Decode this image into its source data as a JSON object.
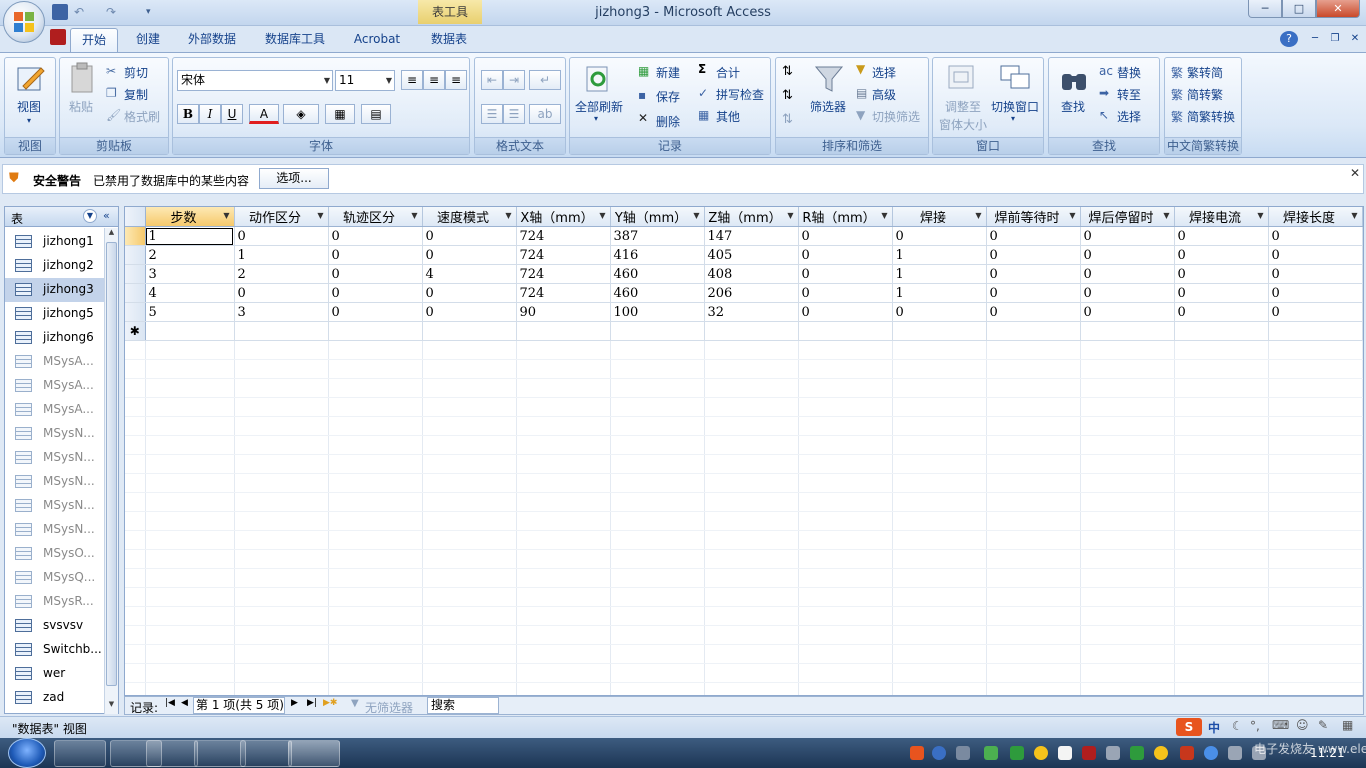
{
  "window": {
    "title": "jizhong3 - Microsoft Access",
    "context_tab": "表工具",
    "min": "─",
    "max": "□",
    "close": "✕",
    "help": "?",
    "doc_min": "─",
    "doc_restore": "❐",
    "doc_close": "✕"
  },
  "ribbon_tabs": [
    "开始",
    "创建",
    "外部数据",
    "数据库工具",
    "Acrobat",
    "数据表"
  ],
  "ribbon": {
    "view": {
      "label": "视图",
      "group": "视图"
    },
    "clipboard": {
      "paste": "粘贴",
      "cut": "剪切",
      "copy": "复制",
      "format_painter": "格式刷",
      "group": "剪贴板"
    },
    "font": {
      "name": "宋体",
      "size": "11",
      "group": "字体",
      "bold": "B",
      "italic": "I",
      "underline": "U",
      "font_color": "A"
    },
    "rich_text": {
      "group": "格式文本"
    },
    "records": {
      "refresh_all": "全部刷新",
      "new": "新建",
      "save": "保存",
      "delete": "删除",
      "totals": "合计",
      "spelling": "拼写检查",
      "more": "其他",
      "group": "记录"
    },
    "sort_filter": {
      "filter": "筛选器",
      "selection": "选择",
      "advanced": "高级",
      "toggle_filter": "切换筛选",
      "group": "排序和筛选"
    },
    "window": {
      "size_to_fit": "调整至",
      "size_to_fit2": "窗体大小",
      "switch_windows": "切换窗口",
      "group": "窗口"
    },
    "find": {
      "find": "查找",
      "replace": "替换",
      "goto": "转至",
      "select": "选择",
      "group": "查找"
    },
    "chinese": {
      "t2s": "繁转简",
      "s2t": "简转繁",
      "convert": "简繁转换",
      "group": "中文简繁转换"
    }
  },
  "security": {
    "title": "安全警告",
    "message": "已禁用了数据库中的某些内容",
    "options": "选项...",
    "close": "✕"
  },
  "nav": {
    "header": "表",
    "items": [
      {
        "name": "jizhong1",
        "system": false,
        "selected": false
      },
      {
        "name": "jizhong2",
        "system": false,
        "selected": false
      },
      {
        "name": "jizhong3",
        "system": false,
        "selected": true
      },
      {
        "name": "jizhong5",
        "system": false,
        "selected": false
      },
      {
        "name": "jizhong6",
        "system": false,
        "selected": false
      },
      {
        "name": "MSysA...",
        "system": true,
        "selected": false
      },
      {
        "name": "MSysA...",
        "system": true,
        "selected": false
      },
      {
        "name": "MSysA...",
        "system": true,
        "selected": false
      },
      {
        "name": "MSysN...",
        "system": true,
        "selected": false
      },
      {
        "name": "MSysN...",
        "system": true,
        "selected": false
      },
      {
        "name": "MSysN...",
        "system": true,
        "selected": false
      },
      {
        "name": "MSysN...",
        "system": true,
        "selected": false
      },
      {
        "name": "MSysN...",
        "system": true,
        "selected": false
      },
      {
        "name": "MSysO...",
        "system": true,
        "selected": false
      },
      {
        "name": "MSysQ...",
        "system": true,
        "selected": false
      },
      {
        "name": "MSysR...",
        "system": true,
        "selected": false
      },
      {
        "name": "svsvsv",
        "system": false,
        "selected": false
      },
      {
        "name": "Switchb...",
        "system": false,
        "selected": false
      },
      {
        "name": "wer",
        "system": false,
        "selected": false
      },
      {
        "name": "zad",
        "system": false,
        "selected": false
      }
    ]
  },
  "table": {
    "columns": [
      "步数",
      "动作区分",
      "轨迹区分",
      "速度模式",
      "X轴（mm）",
      "Y轴（mm）",
      "Z轴（mm）",
      "R轴（mm）",
      "焊接",
      "焊前等待时",
      "焊后停留时",
      "焊接电流",
      "焊接长度"
    ],
    "rows": [
      [
        "1",
        "0",
        "0",
        "0",
        "724",
        "387",
        "147",
        "0",
        "0",
        "0",
        "0",
        "0",
        "0"
      ],
      [
        "2",
        "1",
        "0",
        "0",
        "724",
        "416",
        "405",
        "0",
        "1",
        "0",
        "0",
        "0",
        "0"
      ],
      [
        "3",
        "2",
        "0",
        "4",
        "724",
        "460",
        "408",
        "0",
        "1",
        "0",
        "0",
        "0",
        "0"
      ],
      [
        "4",
        "0",
        "0",
        "0",
        "724",
        "460",
        "206",
        "0",
        "1",
        "0",
        "0",
        "0",
        "0"
      ],
      [
        "5",
        "3",
        "0",
        "0",
        "90",
        "100",
        "32",
        "0",
        "0",
        "0",
        "0",
        "0",
        "0"
      ]
    ],
    "new_row_marker": "✱"
  },
  "record_nav": {
    "label": "记录:",
    "position": "第 1 项(共 5 项)",
    "filter": "无筛选器",
    "search": "搜索"
  },
  "status": {
    "view": "\"数据表\" 视图",
    "ime": "中",
    "clock": "11:21"
  },
  "watermark": "电子发烧友 www.elecfans.com"
}
